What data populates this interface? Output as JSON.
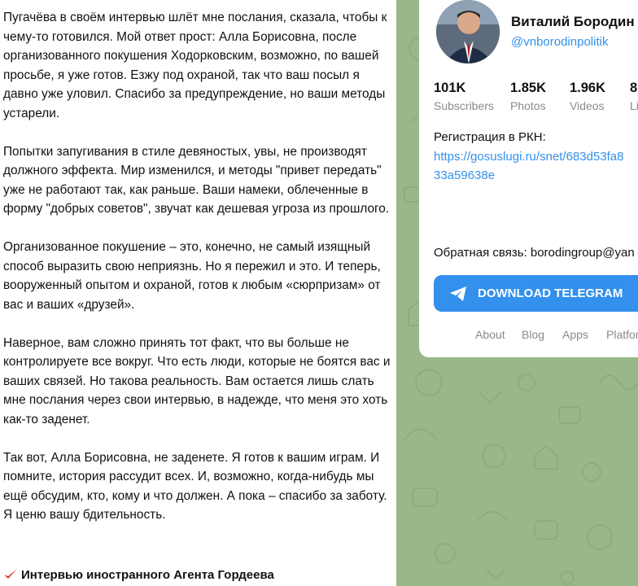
{
  "post": {
    "paragraphs": [
      "Пугачёва в своём интервью шлёт мне послания, сказала, чтобы к чему-то готовился. Мой ответ прост: Алла Борисовна, после организованного покушения Ходорковским, возможно, по вашей просьбе, я уже готов. Езжу под охраной, так что ваш посыл я давно уже уловил. Спасибо за предупреждение, но ваши методы устарели.",
      "Попытки запугивания в стиле девяностых, увы, не производят должного эффекта. Мир изменился, и методы \"привет передать\" уже не работают так, как раньше. Ваши намеки, облеченные в форму \"добрых советов\", звучат как дешевая угроза из прошлого.",
      "Организованное покушение – это, конечно, не самый изящный способ выразить свою неприязнь. Но я пережил и это. И теперь, вооруженный опытом и охраной, готов к любым «сюрпризам» от вас и ваших «друзей».",
      "Наверное, вам сложно принять тот факт, что вы больше не контролируете все вокруг. Что есть люди, которые не боятся вас и ваших связей. Но такова реальность. Вам остается лишь слать мне послания через свои интервью, в надежде, что меня это хоть как-то заденет.",
      "Так вот, Алла Борисовна, не заденете. Я готов к вашим играм. И помните, история рассудит всех. И, возможно, когда-нибудь мы ещё обсудим, кто, кому и что должен. А пока – спасибо за заботу. Я ценю вашу бдительность."
    ],
    "footer_link": "Интервью иностранного Агента Гордеева",
    "footer_icon": "check-mark-icon"
  },
  "channel": {
    "name": "Виталий Бородин",
    "handle": "@vnborodinpolitik",
    "stats": [
      {
        "value": "101K",
        "label": "Subscribers"
      },
      {
        "value": "1.85K",
        "label": "Photos"
      },
      {
        "value": "1.96K",
        "label": "Videos"
      },
      {
        "value": "8",
        "label": "Li"
      }
    ],
    "registration_label": "Регистрация в РКН:",
    "registration_link_line1": "https://gosuslugi.ru/snet/683d53fa8",
    "registration_link_line2": "33a59638e",
    "feedback": "Обратная связь: borodingroup@yan",
    "download_button": "DOWNLOAD TELEGRAM",
    "nav": [
      "About",
      "Blog",
      "Apps",
      "Platforms"
    ]
  },
  "colors": {
    "accent": "#3390ec",
    "background_pattern": "#99b88a",
    "check_mark": "#e5322d"
  }
}
